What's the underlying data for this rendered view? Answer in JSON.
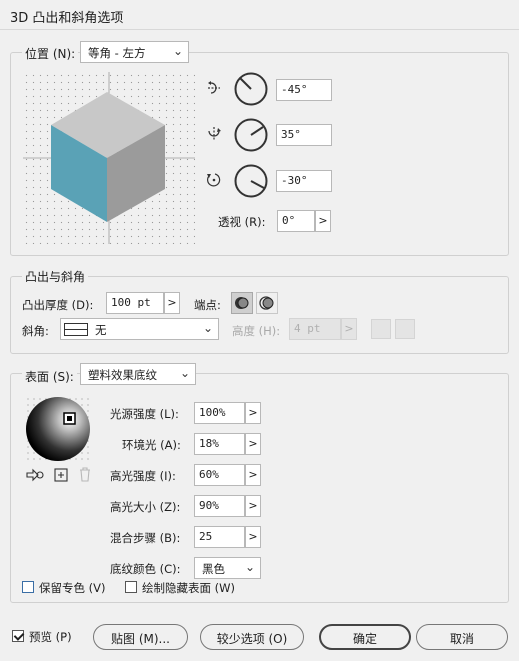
{
  "dialog": {
    "title": "3D 凸出和斜角选项"
  },
  "position": {
    "label": "位置 (N):",
    "preset": "等角 - 左方",
    "x_rotation": "-45°",
    "y_rotation": "35°",
    "z_rotation": "-30°",
    "perspective_label": "透视 (R):",
    "perspective": "0°",
    "step_symbol": ">"
  },
  "extrude": {
    "section_title": "凸出与斜角",
    "depth_label": "凸出厚度 (D):",
    "depth": "100 pt",
    "cap_label": "端点:",
    "bevel_label": "斜角:",
    "bevel": "无",
    "height_label": "高度 (H):",
    "height": "4 pt"
  },
  "surface": {
    "label": "表面 (S):",
    "type": "塑料效果底纹",
    "light_intensity_label": "光源强度 (L):",
    "light_intensity": "100%",
    "ambient_label": "环境光 (A):",
    "ambient": "18%",
    "highlight_intensity_label": "高光强度 (I):",
    "highlight_intensity": "60%",
    "highlight_size_label": "高光大小 (Z):",
    "highlight_size": "90%",
    "blend_steps_label": "混合步骤 (B):",
    "blend_steps": "25",
    "shading_color_label": "底纹颜色 (C):",
    "shading_color": "黑色",
    "preserve_spot_label": "保留专色 (V)",
    "draw_hidden_label": "绘制隐藏表面 (W)"
  },
  "footer": {
    "preview_label": "预览 (P)",
    "map_button": "贴图 (M)...",
    "fewer_options_button": "较少选项 (O)",
    "ok_button": "确定",
    "cancel_button": "取消"
  },
  "colors": {
    "cube_top": "#c8c8c8",
    "cube_left": "#5aa2b6",
    "cube_right": "#9b9b9b",
    "background": "#f0f0f0"
  },
  "icons": {
    "x_axis": "rotate-x-icon",
    "y_axis": "rotate-y-icon",
    "z_axis": "rotate-z-icon",
    "move_light": "move-light-back-icon",
    "new_light": "new-light-icon",
    "delete_light": "delete-light-icon"
  }
}
